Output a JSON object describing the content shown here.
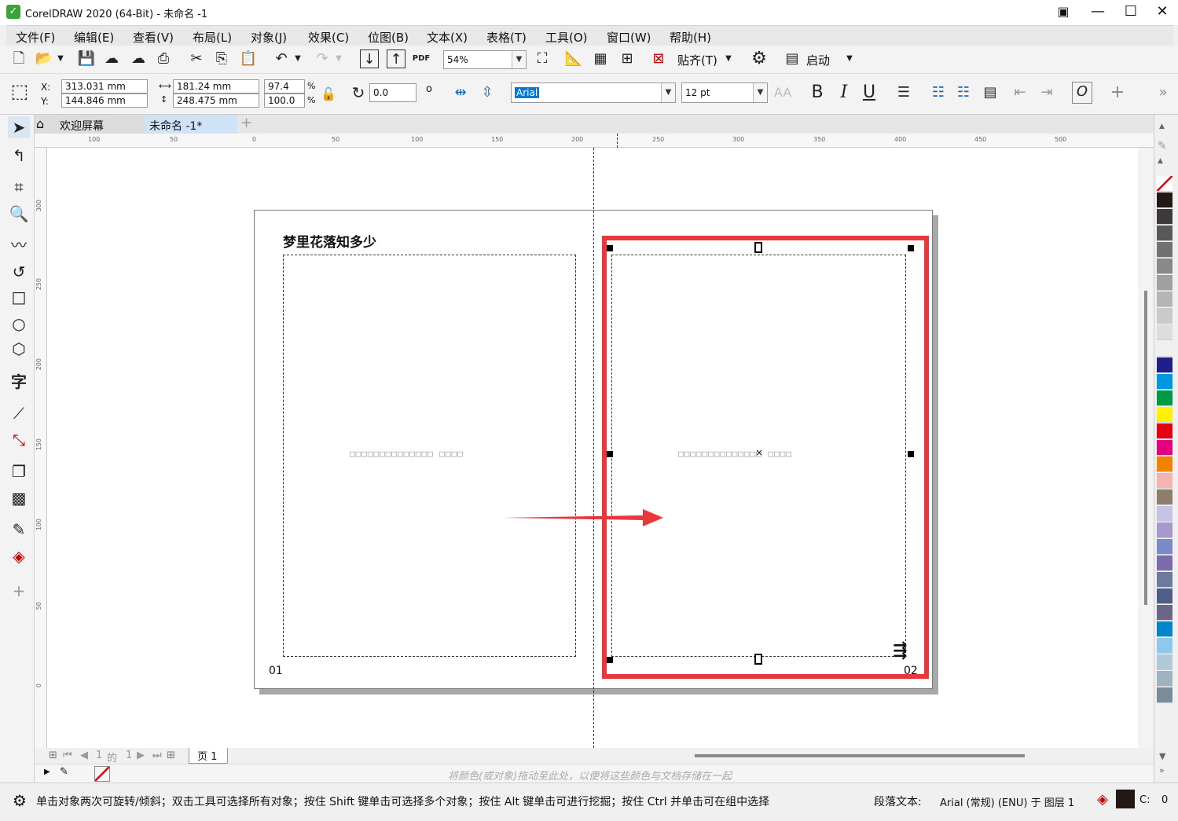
{
  "window": {
    "title": "CorelDRAW 2020 (64-Bit) - 未命名 -1",
    "controls": [
      "minimize-icon",
      "maximize-icon",
      "close-icon"
    ]
  },
  "menu": [
    {
      "label": "文件(F)"
    },
    {
      "label": "编辑(E)"
    },
    {
      "label": "查看(V)"
    },
    {
      "label": "布局(L)"
    },
    {
      "label": "对象(J)"
    },
    {
      "label": "效果(C)"
    },
    {
      "label": "位图(B)"
    },
    {
      "label": "文本(X)"
    },
    {
      "label": "表格(T)"
    },
    {
      "label": "工具(O)"
    },
    {
      "label": "窗口(W)"
    },
    {
      "label": "帮助(H)"
    }
  ],
  "toolbar1": {
    "zoom_value": "54%",
    "snap_label": "贴齐(T)",
    "launch_label": "启动",
    "pdf_label": "PDF"
  },
  "toolbar2": {
    "x_label": "X:",
    "y_label": "Y:",
    "x_value": "313.031 mm",
    "y_value": "144.846 mm",
    "width_value": "181.24 mm",
    "height_value": "248.475 mm",
    "scale_x": "97.4",
    "scale_y": "100.0",
    "pct": "%",
    "rotation": "0.0",
    "degree": "o",
    "font_name": "Arial",
    "font_size": "12 pt",
    "bold": "B",
    "italic": "I",
    "underline": "U"
  },
  "tabs": {
    "welcome": "欢迎屏幕",
    "document": "未命名 -1*",
    "add": "+"
  },
  "ruler": {
    "h_ticks": [
      "100",
      "50",
      "0",
      "50",
      "100",
      "150",
      "200",
      "250",
      "300",
      "350",
      "400",
      "450",
      "500"
    ],
    "v_ticks": [
      "300",
      "250",
      "200",
      "150",
      "100",
      "50",
      "0"
    ]
  },
  "canvas": {
    "page_title": "梦里花落知多少",
    "left_frame_text": "□□□□□□□□□□□□□□ □□□□",
    "right_frame_text": "□□□□□□□□□□□□□□ □□□□",
    "page_num_left": "01",
    "page_num_right": "02",
    "highlight_color": "#e8383d",
    "arrow_color": "#e8383d"
  },
  "pagenav": {
    "current": "1",
    "of": "的",
    "total": "1",
    "page_tab": "页 1"
  },
  "docpalette": {
    "hint": "将颜色(或对象)拖动至此处，以便将这些颜色与文档存储在一起"
  },
  "status": {
    "message": "单击对象两次可旋转/倾斜；双击工具可选择所有对象；按住 Shift 键单击可选择多个对象；按住 Alt 键单击可进行挖掘；按住 Ctrl 并单击可在组中选择",
    "text_info": "段落文本:",
    "font_info": "Arial (常规) (ENU) 于 图层 1",
    "c_label": "C:",
    "c_value": "0"
  },
  "palette": [
    "#ffffff",
    "#231815",
    "#3e3a39",
    "#595757",
    "#727171",
    "#898989",
    "#9fa0a0",
    "#b5b5b6",
    "#c9caca",
    "#dcdddd",
    "#efefef",
    "#1d2088",
    "#0097e0",
    "#009944",
    "#fff100",
    "#e60012",
    "#e4007f",
    "#f08300",
    "#f4b4b0",
    "#8f7d6e",
    "#c5c4e4",
    "#a59acb",
    "#7a8bc8",
    "#7b6cae",
    "#6c7a9e",
    "#4f5d87",
    "#6b6689",
    "#0086cc",
    "#8fc8ec",
    "#b0c9d8",
    "#9fb3c0",
    "#7a8c99"
  ]
}
